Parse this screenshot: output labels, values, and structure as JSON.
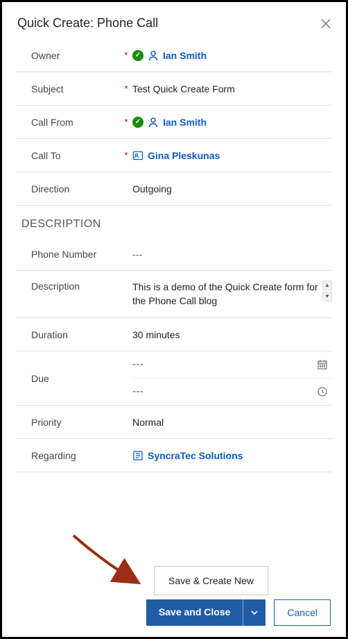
{
  "header": {
    "title": "Quick Create: Phone Call"
  },
  "fields": {
    "owner": {
      "label": "Owner",
      "required": "*",
      "value": "Ian Smith"
    },
    "subject": {
      "label": "Subject",
      "required": "*",
      "value": "Test Quick Create Form"
    },
    "callFrom": {
      "label": "Call From",
      "required": "*",
      "value": "Ian Smith"
    },
    "callTo": {
      "label": "Call To",
      "required": "*",
      "value": "Gina Pleskunas"
    },
    "direction": {
      "label": "Direction",
      "value": "Outgoing"
    }
  },
  "sections": {
    "description": {
      "title": "DESCRIPTION"
    }
  },
  "descFields": {
    "phoneNumber": {
      "label": "Phone Number",
      "value": "---"
    },
    "description": {
      "label": "Description",
      "value": "This is a demo of the Quick Create form for the Phone Call blog"
    },
    "duration": {
      "label": "Duration",
      "value": "30 minutes"
    },
    "dueDate": {
      "label": "Due",
      "date": "---",
      "time": "---"
    },
    "priority": {
      "label": "Priority",
      "value": "Normal"
    },
    "regarding": {
      "label": "Regarding",
      "value": "SyncraTec Solutions"
    }
  },
  "footer": {
    "menuItem": "Save & Create New",
    "primary": "Save and Close",
    "secondary": "Cancel"
  }
}
